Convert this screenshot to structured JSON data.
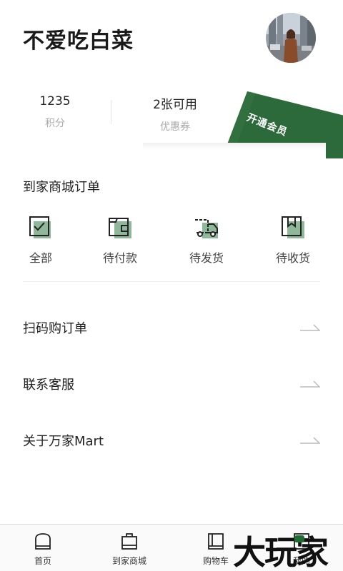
{
  "profile": {
    "username": "不爱吃白菜"
  },
  "stats": {
    "points_value": "1235",
    "points_label": "积分",
    "coupons_value": "2张可用",
    "coupons_label": "优惠券"
  },
  "vip": {
    "label": "开通会员",
    "color": "#2d6a3b"
  },
  "orders": {
    "title": "到家商城订单",
    "items": [
      {
        "label": "全部",
        "icon": "all-orders-icon"
      },
      {
        "label": "待付款",
        "icon": "wallet-icon"
      },
      {
        "label": "待发货",
        "icon": "truck-icon"
      },
      {
        "label": "待收货",
        "icon": "package-icon"
      }
    ]
  },
  "menu": [
    {
      "label": "扫码购订单"
    },
    {
      "label": "联系客服"
    },
    {
      "label": "关于万家Mart"
    }
  ],
  "tabbar": [
    {
      "label": "首页",
      "icon": "home-icon"
    },
    {
      "label": "到家商城",
      "icon": "bag-icon"
    },
    {
      "label": "购物车",
      "icon": "cart-icon"
    },
    {
      "label": "我的",
      "icon": "profile-icon"
    }
  ],
  "watermark": "大玩家",
  "accent_green": "#8fb89a"
}
